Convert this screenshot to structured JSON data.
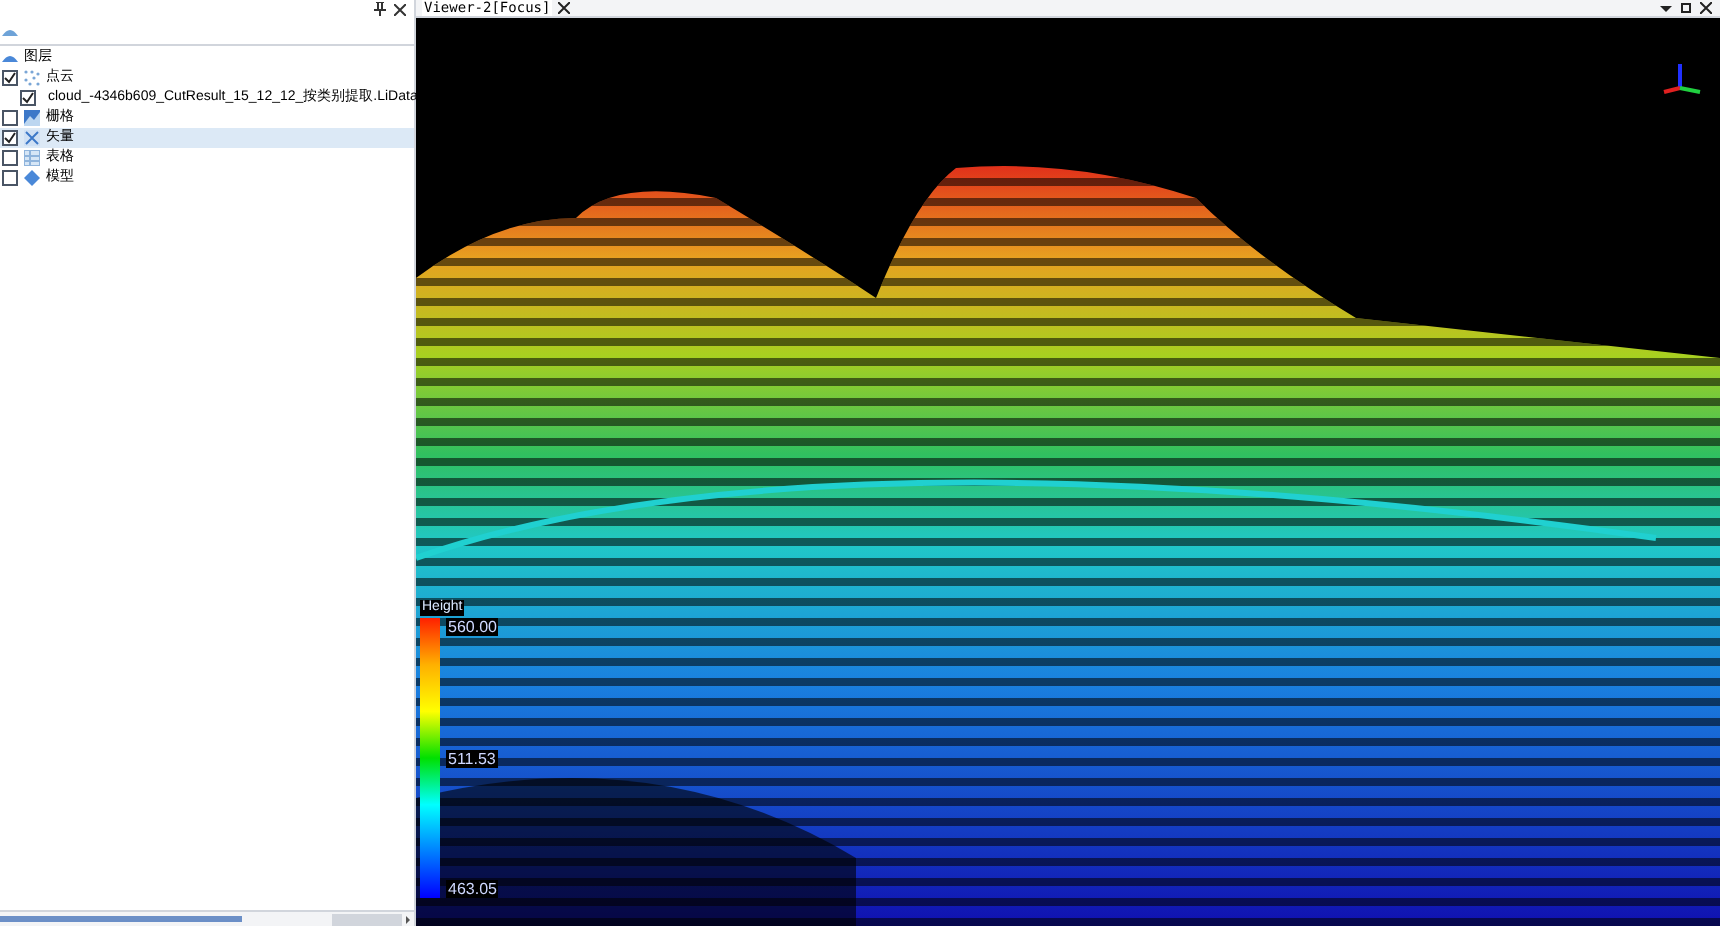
{
  "layer_tree": {
    "label": "图层",
    "children": [
      {
        "label": "点云",
        "kind": "pointcloud",
        "checked": true,
        "selected": false,
        "children": [
          {
            "label": "cloud_-4346b609_CutResult_15_12_12_按类别提取.LiData",
            "kind": "pointcloud",
            "checked": true,
            "selected": false
          }
        ]
      },
      {
        "label": "栅格",
        "kind": "raster",
        "checked": false,
        "selected": false
      },
      {
        "label": "矢量",
        "kind": "vector",
        "checked": true,
        "selected": true
      },
      {
        "label": "表格",
        "kind": "table",
        "checked": false,
        "selected": false
      },
      {
        "label": "模型",
        "kind": "model",
        "checked": false,
        "selected": false
      }
    ]
  },
  "viewer": {
    "tab": "Viewer-2[Focus]",
    "legend": {
      "title": "Height",
      "labels": [
        "560.00",
        "511.53",
        "463.05"
      ]
    }
  }
}
